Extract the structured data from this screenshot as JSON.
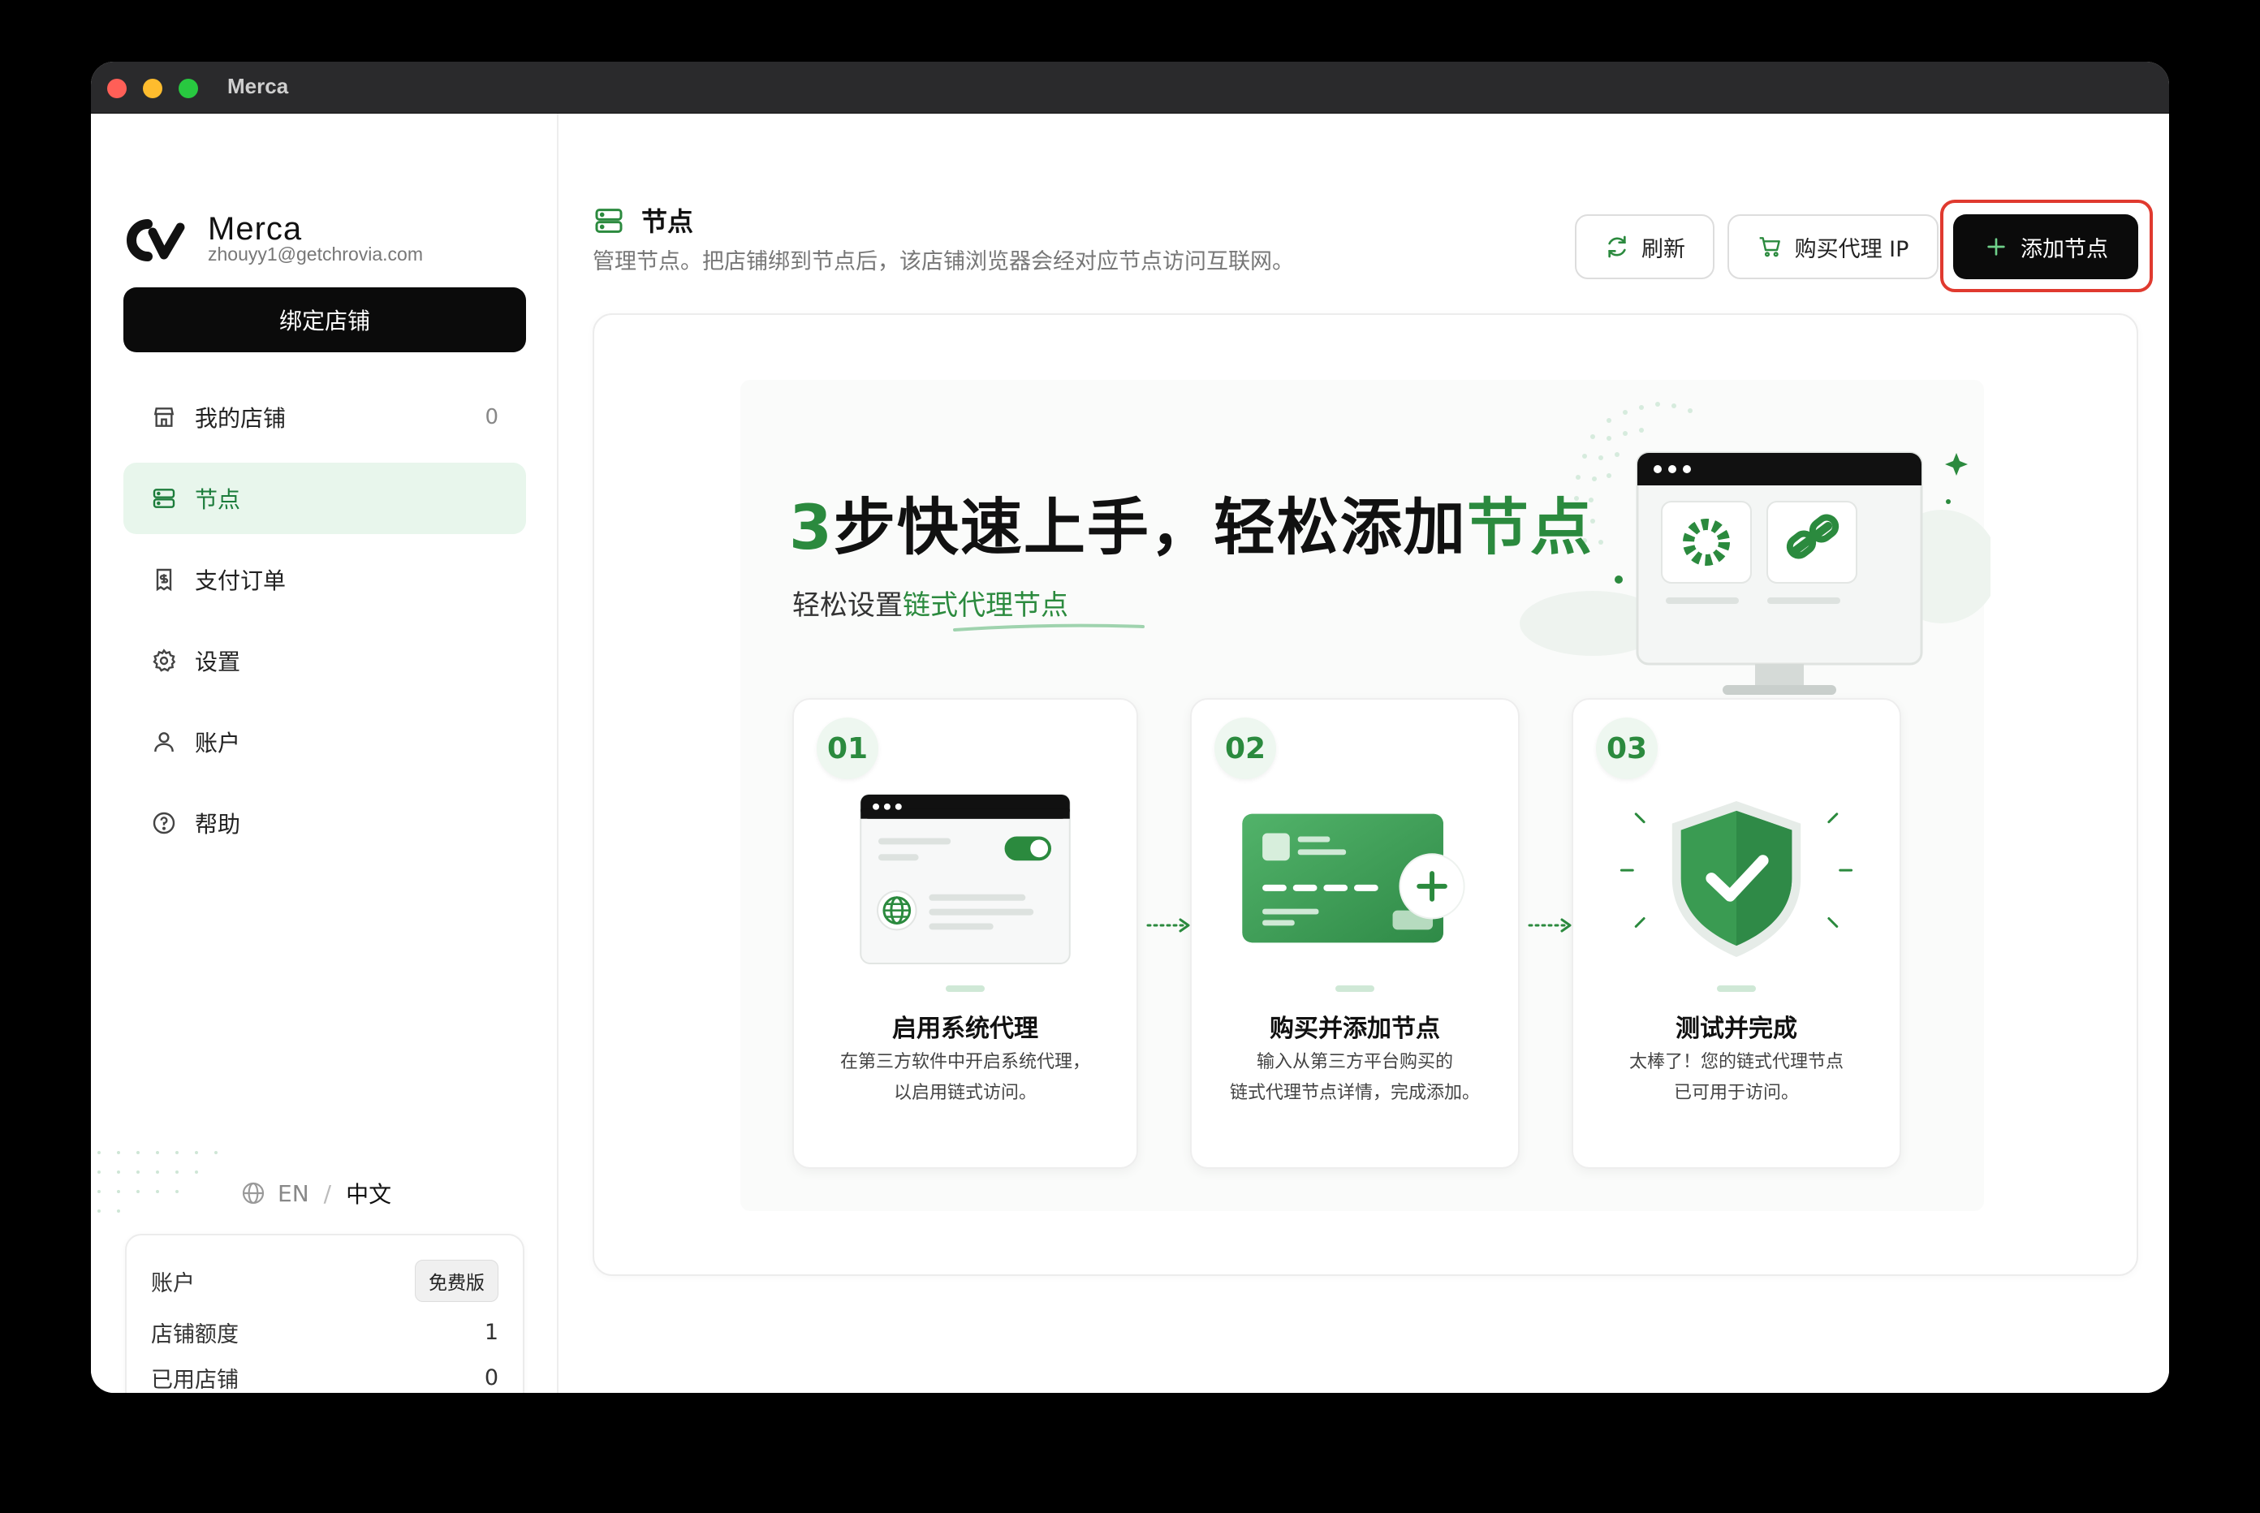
{
  "window": {
    "title": "Merca"
  },
  "brand": {
    "name": "Merca",
    "email": "zhouyy1@getchrovia.com"
  },
  "sidebar": {
    "bind_button": "绑定店铺",
    "items": [
      {
        "label": "我的店铺",
        "icon": "store-icon",
        "count": "0"
      },
      {
        "label": "节点",
        "icon": "server-icon",
        "active": true
      },
      {
        "label": "支付订单",
        "icon": "receipt-icon"
      },
      {
        "label": "设置",
        "icon": "gear-icon"
      },
      {
        "label": "账户",
        "icon": "user-icon"
      },
      {
        "label": "帮助",
        "icon": "help-icon"
      }
    ],
    "lang": {
      "en": "EN",
      "sep": "/",
      "zh": "中文"
    },
    "account_card": {
      "title": "账户",
      "plan_badge": "免费版",
      "quota_label": "店铺额度",
      "quota_value": "1",
      "used_label": "已用店铺",
      "used_value": "0"
    }
  },
  "header": {
    "title": "节点",
    "subtitle": "管理节点。把店铺绑到节点后，该店铺浏览器会经对应节点访问互联网。",
    "refresh_label": "刷新",
    "buy_label": "购买代理 IP",
    "add_label": "添加节点"
  },
  "hero": {
    "title_num": "3",
    "title_a": "步快速上手，轻松添加",
    "title_b": "节点",
    "sub_a": "轻松设置",
    "sub_b": "链式代理节点"
  },
  "steps": [
    {
      "num": "01",
      "title": "启用系统代理",
      "desc_1": "在第三方软件中开启系统代理，",
      "desc_2": "以启用链式访问。"
    },
    {
      "num": "02",
      "title": "购买并添加节点",
      "desc_1": "输入从第三方平台购买的",
      "desc_2": "链式代理节点详情，完成添加。"
    },
    {
      "num": "03",
      "title": "测试并完成",
      "desc_1": "太棒了！您的链式代理节点",
      "desc_2": "已可用于访问。"
    }
  ],
  "colors": {
    "accent": "#2b8a3e",
    "active_bg": "#e8f6ec",
    "primary_btn": "#0b0b0b",
    "highlight": "#e03a2f"
  }
}
